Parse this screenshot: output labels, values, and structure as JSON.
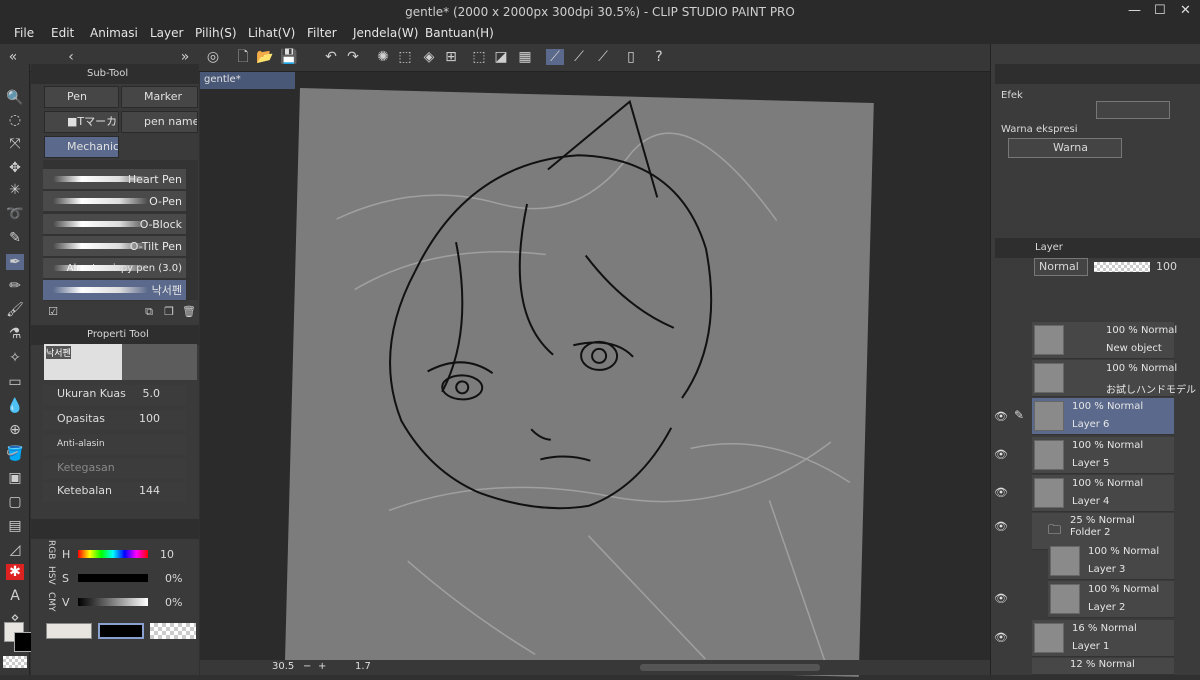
{
  "window": {
    "title": "gentle* (2000 x 2000px 300dpi 30.5%)  - CLIP STUDIO PAINT PRO",
    "minimize": "—",
    "maximize": "☐",
    "close": "✕"
  },
  "menu": [
    "File",
    "Edit",
    "Animasi",
    "Layer",
    "Pilih(S)",
    "Lihat(V)",
    "Filter",
    "Jendela(W)",
    "Bantuan(H)"
  ],
  "subtool": {
    "tab": "Sub-Tool",
    "buttons": [
      "Pen",
      "Marker",
      "■Tマーカー",
      "pen name",
      "Mechanica"
    ],
    "brushes": [
      "Heart Pen",
      "O-Pen",
      "O-Block",
      "O-Tilt Pen",
      "Alma's crispy pen (3.0)",
      "낙서펜"
    ]
  },
  "tool_property": {
    "tab": "Properti Tool",
    "preview_label": "낙서펜",
    "brush_size_label": "Ukuran Kuas",
    "brush_size": "5.0",
    "opacity_label": "Opasitas",
    "opacity": "100",
    "antialias_label": "Anti-alasin",
    "hardness_label": "Ketegasan",
    "thickness_label": "Ketebalan",
    "thickness": "144"
  },
  "color": {
    "tabs": [
      "RGB",
      "HSV",
      "CMY"
    ],
    "h_label": "H",
    "h_value": "10",
    "s_label": "S",
    "s_value": "0%",
    "v_label": "V",
    "v_value": "0%"
  },
  "doc_tab": "gentle*",
  "status": {
    "zoom": "30.5",
    "rotation": "1.7",
    "minus": "−",
    "plus": "+"
  },
  "effect": {
    "label": "Efek",
    "color_expr_label": "Warna ekspresi",
    "color_mode": "Warna"
  },
  "layer_panel": {
    "tab": "Layer",
    "blend_mode": "Normal",
    "opacity": "100",
    "layers": [
      {
        "mode": "100 % Normal",
        "name": "New object",
        "visible": false
      },
      {
        "mode": "100 % Normal",
        "name": "お試しハンドモデル",
        "visible": false
      },
      {
        "mode": "100 % Normal",
        "name": "Layer 6",
        "visible": true,
        "selected": true
      },
      {
        "mode": "100 % Normal",
        "name": "Layer 5",
        "visible": true
      },
      {
        "mode": "100 % Normal",
        "name": "Layer 4",
        "visible": true
      },
      {
        "mode": "25 % Normal",
        "name": "Folder 2",
        "visible": true,
        "folder": true
      },
      {
        "mode": "100 % Normal",
        "name": "Layer 3",
        "visible": false
      },
      {
        "mode": "100 % Normal",
        "name": "Layer 2",
        "visible": true
      },
      {
        "mode": "16 % Normal",
        "name": "Layer 1",
        "visible": true
      },
      {
        "mode": "12 % Normal",
        "name": "",
        "visible": false,
        "folder": true
      }
    ]
  },
  "colors": {
    "accent": "#5b6a8c",
    "panel": "#3a3a3a",
    "canvas_bg": "#2b2b2b",
    "paper": "#7c7c7c"
  }
}
